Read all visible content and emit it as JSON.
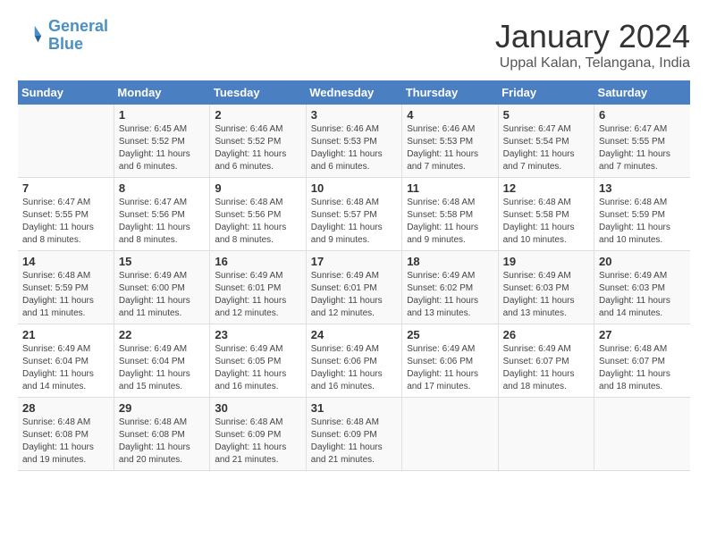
{
  "header": {
    "logo_line1": "General",
    "logo_line2": "Blue",
    "title": "January 2024",
    "subtitle": "Uppal Kalan, Telangana, India"
  },
  "weekdays": [
    "Sunday",
    "Monday",
    "Tuesday",
    "Wednesday",
    "Thursday",
    "Friday",
    "Saturday"
  ],
  "weeks": [
    [
      {
        "day": "",
        "info": ""
      },
      {
        "day": "1",
        "info": "Sunrise: 6:45 AM\nSunset: 5:52 PM\nDaylight: 11 hours\nand 6 minutes."
      },
      {
        "day": "2",
        "info": "Sunrise: 6:46 AM\nSunset: 5:52 PM\nDaylight: 11 hours\nand 6 minutes."
      },
      {
        "day": "3",
        "info": "Sunrise: 6:46 AM\nSunset: 5:53 PM\nDaylight: 11 hours\nand 6 minutes."
      },
      {
        "day": "4",
        "info": "Sunrise: 6:46 AM\nSunset: 5:53 PM\nDaylight: 11 hours\nand 7 minutes."
      },
      {
        "day": "5",
        "info": "Sunrise: 6:47 AM\nSunset: 5:54 PM\nDaylight: 11 hours\nand 7 minutes."
      },
      {
        "day": "6",
        "info": "Sunrise: 6:47 AM\nSunset: 5:55 PM\nDaylight: 11 hours\nand 7 minutes."
      }
    ],
    [
      {
        "day": "7",
        "info": "Sunrise: 6:47 AM\nSunset: 5:55 PM\nDaylight: 11 hours\nand 8 minutes."
      },
      {
        "day": "8",
        "info": "Sunrise: 6:47 AM\nSunset: 5:56 PM\nDaylight: 11 hours\nand 8 minutes."
      },
      {
        "day": "9",
        "info": "Sunrise: 6:48 AM\nSunset: 5:56 PM\nDaylight: 11 hours\nand 8 minutes."
      },
      {
        "day": "10",
        "info": "Sunrise: 6:48 AM\nSunset: 5:57 PM\nDaylight: 11 hours\nand 9 minutes."
      },
      {
        "day": "11",
        "info": "Sunrise: 6:48 AM\nSunset: 5:58 PM\nDaylight: 11 hours\nand 9 minutes."
      },
      {
        "day": "12",
        "info": "Sunrise: 6:48 AM\nSunset: 5:58 PM\nDaylight: 11 hours\nand 10 minutes."
      },
      {
        "day": "13",
        "info": "Sunrise: 6:48 AM\nSunset: 5:59 PM\nDaylight: 11 hours\nand 10 minutes."
      }
    ],
    [
      {
        "day": "14",
        "info": "Sunrise: 6:48 AM\nSunset: 5:59 PM\nDaylight: 11 hours\nand 11 minutes."
      },
      {
        "day": "15",
        "info": "Sunrise: 6:49 AM\nSunset: 6:00 PM\nDaylight: 11 hours\nand 11 minutes."
      },
      {
        "day": "16",
        "info": "Sunrise: 6:49 AM\nSunset: 6:01 PM\nDaylight: 11 hours\nand 12 minutes."
      },
      {
        "day": "17",
        "info": "Sunrise: 6:49 AM\nSunset: 6:01 PM\nDaylight: 11 hours\nand 12 minutes."
      },
      {
        "day": "18",
        "info": "Sunrise: 6:49 AM\nSunset: 6:02 PM\nDaylight: 11 hours\nand 13 minutes."
      },
      {
        "day": "19",
        "info": "Sunrise: 6:49 AM\nSunset: 6:03 PM\nDaylight: 11 hours\nand 13 minutes."
      },
      {
        "day": "20",
        "info": "Sunrise: 6:49 AM\nSunset: 6:03 PM\nDaylight: 11 hours\nand 14 minutes."
      }
    ],
    [
      {
        "day": "21",
        "info": "Sunrise: 6:49 AM\nSunset: 6:04 PM\nDaylight: 11 hours\nand 14 minutes."
      },
      {
        "day": "22",
        "info": "Sunrise: 6:49 AM\nSunset: 6:04 PM\nDaylight: 11 hours\nand 15 minutes."
      },
      {
        "day": "23",
        "info": "Sunrise: 6:49 AM\nSunset: 6:05 PM\nDaylight: 11 hours\nand 16 minutes."
      },
      {
        "day": "24",
        "info": "Sunrise: 6:49 AM\nSunset: 6:06 PM\nDaylight: 11 hours\nand 16 minutes."
      },
      {
        "day": "25",
        "info": "Sunrise: 6:49 AM\nSunset: 6:06 PM\nDaylight: 11 hours\nand 17 minutes."
      },
      {
        "day": "26",
        "info": "Sunrise: 6:49 AM\nSunset: 6:07 PM\nDaylight: 11 hours\nand 18 minutes."
      },
      {
        "day": "27",
        "info": "Sunrise: 6:48 AM\nSunset: 6:07 PM\nDaylight: 11 hours\nand 18 minutes."
      }
    ],
    [
      {
        "day": "28",
        "info": "Sunrise: 6:48 AM\nSunset: 6:08 PM\nDaylight: 11 hours\nand 19 minutes."
      },
      {
        "day": "29",
        "info": "Sunrise: 6:48 AM\nSunset: 6:08 PM\nDaylight: 11 hours\nand 20 minutes."
      },
      {
        "day": "30",
        "info": "Sunrise: 6:48 AM\nSunset: 6:09 PM\nDaylight: 11 hours\nand 21 minutes."
      },
      {
        "day": "31",
        "info": "Sunrise: 6:48 AM\nSunset: 6:09 PM\nDaylight: 11 hours\nand 21 minutes."
      },
      {
        "day": "",
        "info": ""
      },
      {
        "day": "",
        "info": ""
      },
      {
        "day": "",
        "info": ""
      }
    ]
  ]
}
